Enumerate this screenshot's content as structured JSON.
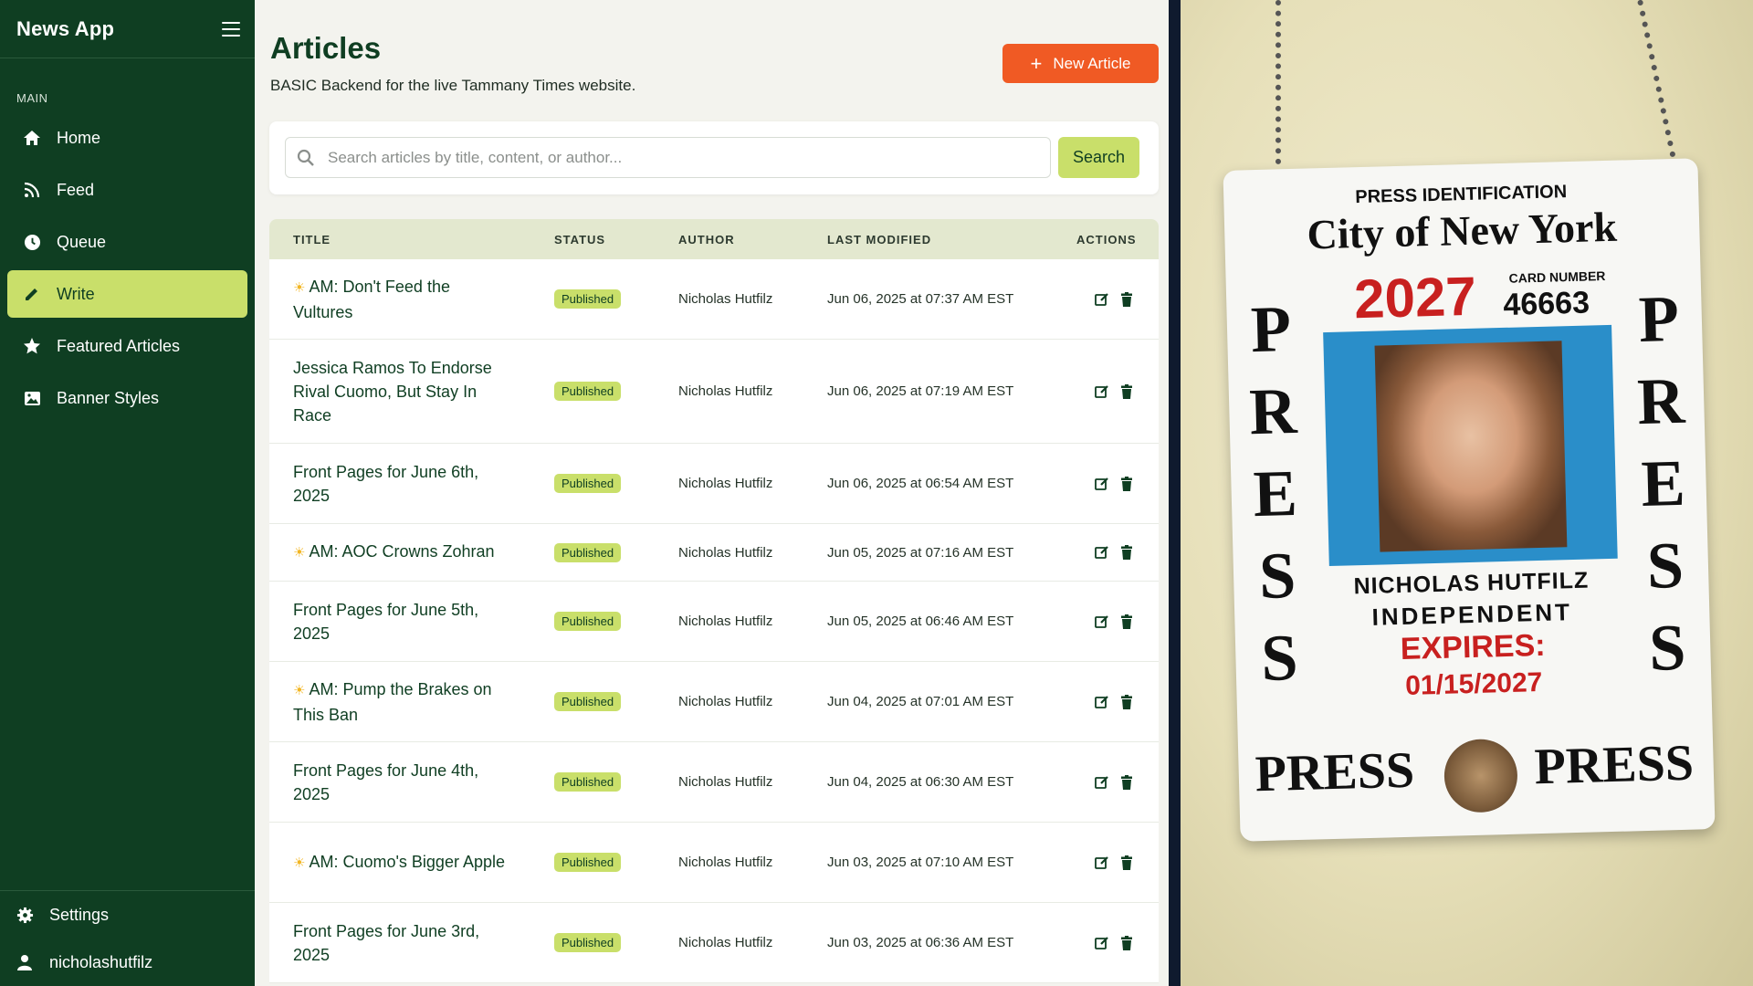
{
  "app": {
    "title": "News App"
  },
  "sidebar": {
    "section_label": "MAIN",
    "items": [
      {
        "label": "Home",
        "icon": "home-icon"
      },
      {
        "label": "Feed",
        "icon": "rss-icon"
      },
      {
        "label": "Queue",
        "icon": "clock-icon"
      },
      {
        "label": "Write",
        "icon": "pencil-icon",
        "active": true
      },
      {
        "label": "Featured Articles",
        "icon": "star-icon"
      },
      {
        "label": "Banner Styles",
        "icon": "image-icon"
      }
    ],
    "bottom": {
      "settings_label": "Settings",
      "user_label": "nicholashutfilz"
    }
  },
  "page": {
    "title": "Articles",
    "subtitle": "BASIC Backend for the live Tammany Times website.",
    "new_button_label": "New Article"
  },
  "search": {
    "placeholder": "Search articles by title, content, or author...",
    "button_label": "Search"
  },
  "table": {
    "headers": [
      "TITLE",
      "STATUS",
      "AUTHOR",
      "LAST MODIFIED",
      "ACTIONS"
    ],
    "rows": [
      {
        "title": "AM: Don't Feed the Vultures",
        "sun": true,
        "status": "Published",
        "author": "Nicholas Hutfilz",
        "modified": "Jun 06, 2025 at 07:37 AM EST"
      },
      {
        "title": "Jessica Ramos To Endorse Rival Cuomo, But Stay In Race",
        "sun": false,
        "status": "Published",
        "author": "Nicholas Hutfilz",
        "modified": "Jun 06, 2025 at 07:19 AM EST"
      },
      {
        "title": "Front Pages for June 6th, 2025",
        "sun": false,
        "status": "Published",
        "author": "Nicholas Hutfilz",
        "modified": "Jun 06, 2025 at 06:54 AM EST"
      },
      {
        "title": "AM: AOC Crowns Zohran",
        "sun": true,
        "status": "Published",
        "author": "Nicholas Hutfilz",
        "modified": "Jun 05, 2025 at 07:16 AM EST"
      },
      {
        "title": "Front Pages for June 5th, 2025",
        "sun": false,
        "status": "Published",
        "author": "Nicholas Hutfilz",
        "modified": "Jun 05, 2025 at 06:46 AM EST"
      },
      {
        "title": "AM: Pump the Brakes on This Ban",
        "sun": true,
        "status": "Published",
        "author": "Nicholas Hutfilz",
        "modified": "Jun 04, 2025 at 07:01 AM EST"
      },
      {
        "title": "Front Pages for June 4th, 2025",
        "sun": false,
        "status": "Published",
        "author": "Nicholas Hutfilz",
        "modified": "Jun 04, 2025 at 06:30 AM EST"
      },
      {
        "title": "AM: Cuomo's Bigger Apple",
        "sun": true,
        "status": "Published",
        "author": "Nicholas Hutfilz",
        "modified": "Jun 03, 2025 at 07:10 AM EST"
      },
      {
        "title": "Front Pages for June 3rd, 2025",
        "sun": false,
        "status": "Published",
        "author": "Nicholas Hutfilz",
        "modified": "Jun 03, 2025 at 06:36 AM EST"
      }
    ]
  },
  "press_card": {
    "heading": "PRESS IDENTIFICATION",
    "city": "City of New York",
    "year": "2027",
    "card_number_label": "CARD NUMBER",
    "card_number": "46663",
    "side_letters": [
      "P",
      "R",
      "E",
      "S",
      "S"
    ],
    "name": "NICHOLAS HUTFILZ",
    "affiliation": "INDEPENDENT",
    "expires_label": "EXPIRES:",
    "expires_date": "01/15/2027",
    "bottom_left": "PRESS",
    "bottom_right": "PRESS"
  },
  "colors": {
    "sidebar_bg": "#0f3e22",
    "accent_lime": "#c9df6a",
    "new_button": "#f05a24",
    "card_red": "#c8201f"
  }
}
